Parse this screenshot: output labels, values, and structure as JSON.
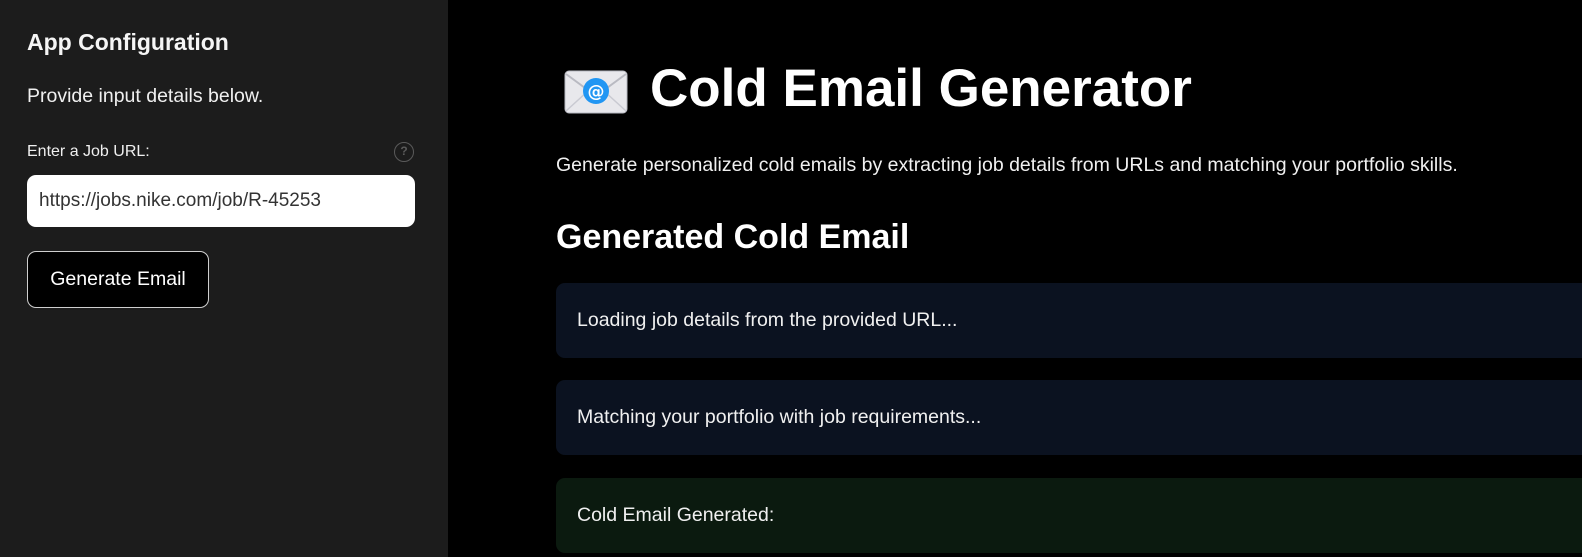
{
  "sidebar": {
    "title": "App Configuration",
    "description": "Provide input details below.",
    "url_label": "Enter a Job URL:",
    "url_value": "https://jobs.nike.com/job/R-45253",
    "help_glyph": "?",
    "generate_button_label": "Generate Email"
  },
  "main": {
    "title": "Cold Email Generator",
    "title_icon": "envelope-at-icon",
    "subtitle": "Generate personalized cold emails by extracting job details from URLs and matching your portfolio skills.",
    "section_heading": "Generated Cold Email",
    "alerts": [
      {
        "text": "Loading job details from the provided URL...",
        "kind": "info"
      },
      {
        "text": "Matching your portfolio with job requirements...",
        "kind": "info"
      },
      {
        "text": "Cold Email Generated:",
        "kind": "success"
      }
    ]
  },
  "colors": {
    "sidebar_bg": "#1c1c1c",
    "main_bg": "#000000",
    "info_bg": "#0b1220",
    "success_bg": "#0b1a0f",
    "accent_blue": "#2196f3"
  }
}
